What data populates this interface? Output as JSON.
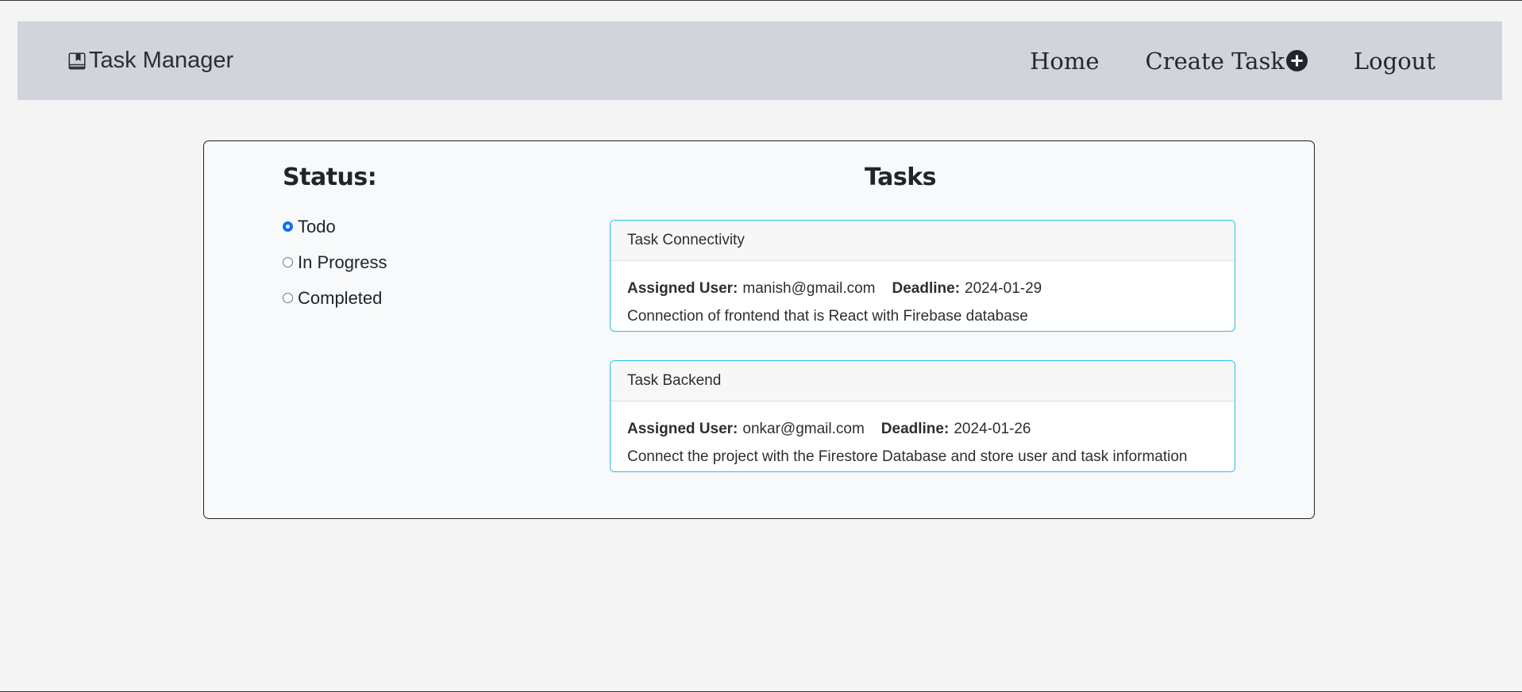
{
  "navbar": {
    "brand": "Task Manager",
    "brand_icon": "book-icon",
    "links": [
      {
        "label": "Home"
      },
      {
        "label": "Create Task",
        "icon": "plus-circle-icon"
      },
      {
        "label": "Logout"
      }
    ]
  },
  "status": {
    "heading": "Status:",
    "options": [
      {
        "label": "Todo",
        "checked": true
      },
      {
        "label": "In Progress",
        "checked": false
      },
      {
        "label": "Completed",
        "checked": false
      }
    ]
  },
  "tasks": {
    "heading": "Tasks",
    "assigned_label": "Assigned User:",
    "deadline_label": "Deadline:",
    "items": [
      {
        "title": "Task Connectivity",
        "assigned_user": "manish@gmail.com",
        "deadline": "2024-01-29",
        "description": "Connection of frontend that is React with Firebase database"
      },
      {
        "title": "Task Backend",
        "assigned_user": "onkar@gmail.com",
        "deadline": "2024-01-26",
        "description": "Connect the project with the Firestore Database and store user and task information"
      }
    ]
  },
  "colors": {
    "navbar_bg": "#d1d4da",
    "card_border": "#23c4e6",
    "radio_checked": "#0d6efd"
  }
}
